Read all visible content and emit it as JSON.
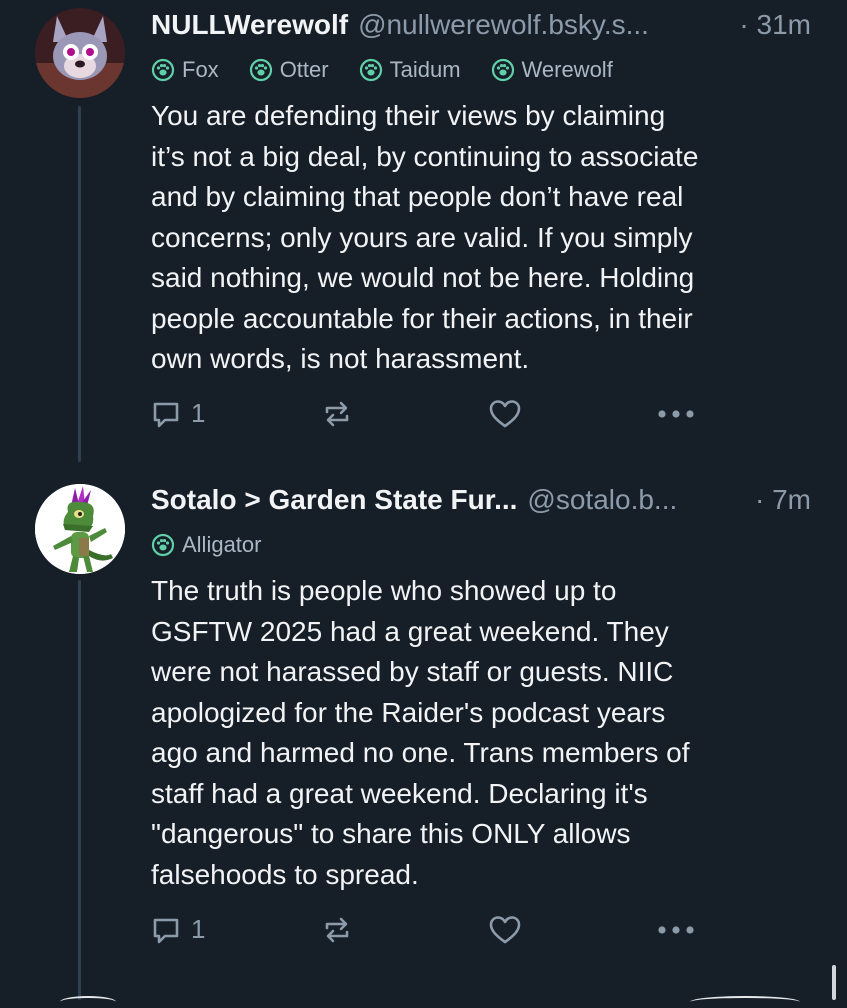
{
  "posts": [
    {
      "author_name": "NULLWerewolf",
      "handle": "@nullwerewolf.bsky.s...",
      "time": "· 31m",
      "tags": [
        "Fox",
        "Otter",
        "Taidum",
        "Werewolf"
      ],
      "text": "You are defending their views by claiming\nit’s not a big deal, by continuing to associate\nand by claiming that people don’t have real\nconcerns; only yours are valid. If you simply\nsaid nothing, we would not be here. Holding\npeople accountable for their actions, in their\nown words, is not harassment.",
      "reply_count": "1"
    },
    {
      "author_name": "Sotalo > Garden State Fur...",
      "handle": "@sotalo.b...",
      "time": "· 7m",
      "tags": [
        "Alligator"
      ],
      "text": "The truth is people who showed up to\nGSFTW 2025 had a great weekend. They\nwere not harassed by staff or guests. NIIC\napologized for the Raider's podcast years\nago and harmed no one. Trans members of\nstaff had a great weekend. Declaring it's\n\"dangerous\" to share this ONLY allows\nfalsehoods to spread.",
      "reply_count": "1"
    }
  ],
  "colors": {
    "background": "#161e27",
    "text": "#f1f3f5",
    "muted": "#8c9baa",
    "thread_line": "#2e4052",
    "tag_icon": "#5fd0a8"
  },
  "icons": {
    "tag": "paw-badge-icon",
    "reply": "reply-bubble-icon",
    "repost": "repost-icon",
    "like": "heart-icon",
    "more": "more-dots-icon"
  }
}
